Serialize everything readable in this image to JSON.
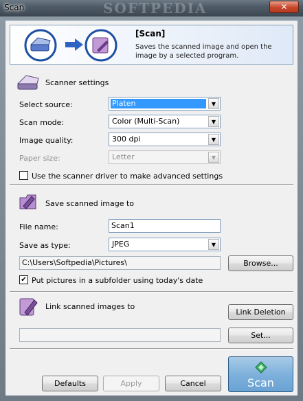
{
  "window": {
    "title": "Scan",
    "watermark": "SOFTPEDIA",
    "close_glyph": "✕"
  },
  "banner": {
    "title": "[Scan]",
    "description": "Saves the scanned image and open the image by a selected program."
  },
  "scanner_settings": {
    "heading": "Scanner settings",
    "select_source": {
      "label": "Select source:",
      "value": "Platen"
    },
    "scan_mode": {
      "label": "Scan mode:",
      "value": "Color (Multi-Scan)"
    },
    "image_quality": {
      "label": "Image quality:",
      "value": "300 dpi"
    },
    "paper_size": {
      "label": "Paper size:",
      "value": "Letter",
      "enabled": false
    },
    "advanced_checkbox": {
      "label": "Use the scanner driver to make advanced settings",
      "checked": false
    }
  },
  "save_section": {
    "heading": "Save scanned image to",
    "file_name": {
      "label": "File name:",
      "value": "Scan1"
    },
    "save_as_type": {
      "label": "Save as type:",
      "value": "JPEG"
    },
    "path": "C:\\Users\\Softpedia\\Pictures\\",
    "browse_label": "Browse...",
    "subfolder_checkbox": {
      "label": "Put pictures in a subfolder using today's date",
      "checked": true,
      "mark": "✔"
    }
  },
  "link_section": {
    "heading": "Link scanned images to",
    "link_deletion_label": "Link Deletion",
    "linked_program": "",
    "set_label": "Set..."
  },
  "footer": {
    "defaults_label": "Defaults",
    "apply_label": "Apply",
    "cancel_label": "Cancel",
    "scan_label": "Scan"
  },
  "icons": {
    "dropdown_arrow": "▼"
  },
  "colors": {
    "selection": "#3399ff",
    "scan_button": "#7eb1dc",
    "close_button": "#c6472b"
  }
}
